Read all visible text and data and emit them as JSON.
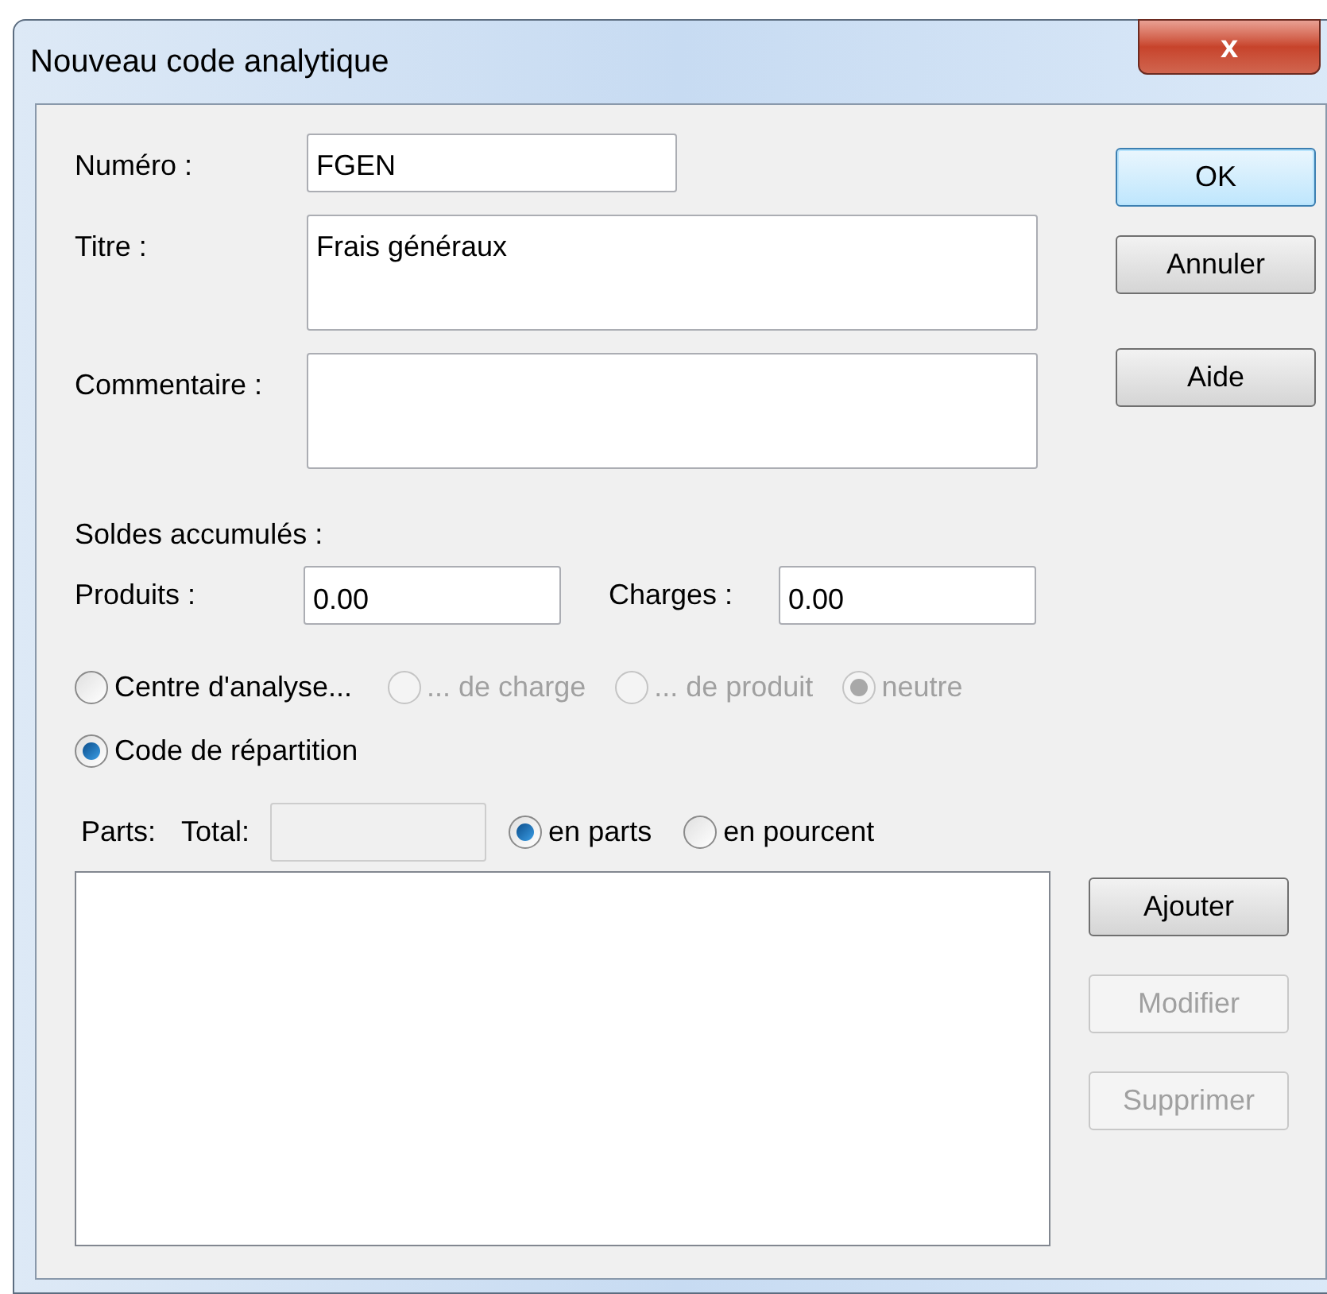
{
  "window": {
    "title": "Nouveau code analytique",
    "close_label": "x"
  },
  "fields": [
    {
      "label": "Numéro :",
      "value": "FGEN",
      "kind": "short"
    },
    {
      "label": "Titre :",
      "value": "Frais généraux",
      "kind": "multi"
    },
    {
      "label": "Commentaire :",
      "kind": "multi"
    }
  ],
  "side_buttons": [
    {
      "label": "OK",
      "default": true,
      "disabled": false
    },
    {
      "label": "Annuler",
      "default": false,
      "disabled": false
    },
    {
      "label": "Aide",
      "default": false,
      "disabled": false
    }
  ],
  "balances": {
    "label": "Soldes accumulés :",
    "fields": [
      {
        "label": "Produits :",
        "value": "0.00"
      },
      {
        "label": "Charges :",
        "value": "0.00"
      }
    ]
  },
  "type_radios": [
    {
      "label": "Centre d'analyse...",
      "selected": false,
      "disabled": false
    },
    {
      "label": "... de charge",
      "selected": false,
      "disabled": true
    },
    {
      "label": "... de produit",
      "selected": false,
      "disabled": true
    },
    {
      "label": "neutre",
      "selected": true,
      "disabled": true
    }
  ],
  "distribution_radio": {
    "label": "Code de répartition",
    "selected": true,
    "disabled": false
  },
  "parts": {
    "label": "Parts:",
    "total_label": "Total:",
    "total_disabled": true,
    "mode_radios": [
      {
        "label": "en parts",
        "selected": true,
        "disabled": false
      },
      {
        "label": "en pourcent",
        "selected": false,
        "disabled": false
      }
    ]
  },
  "list_buttons": [
    {
      "label": "Ajouter",
      "default": false,
      "disabled": false
    },
    {
      "label": "Modifier",
      "disabled": true
    },
    {
      "label": "Supprimer",
      "disabled": true
    }
  ]
}
